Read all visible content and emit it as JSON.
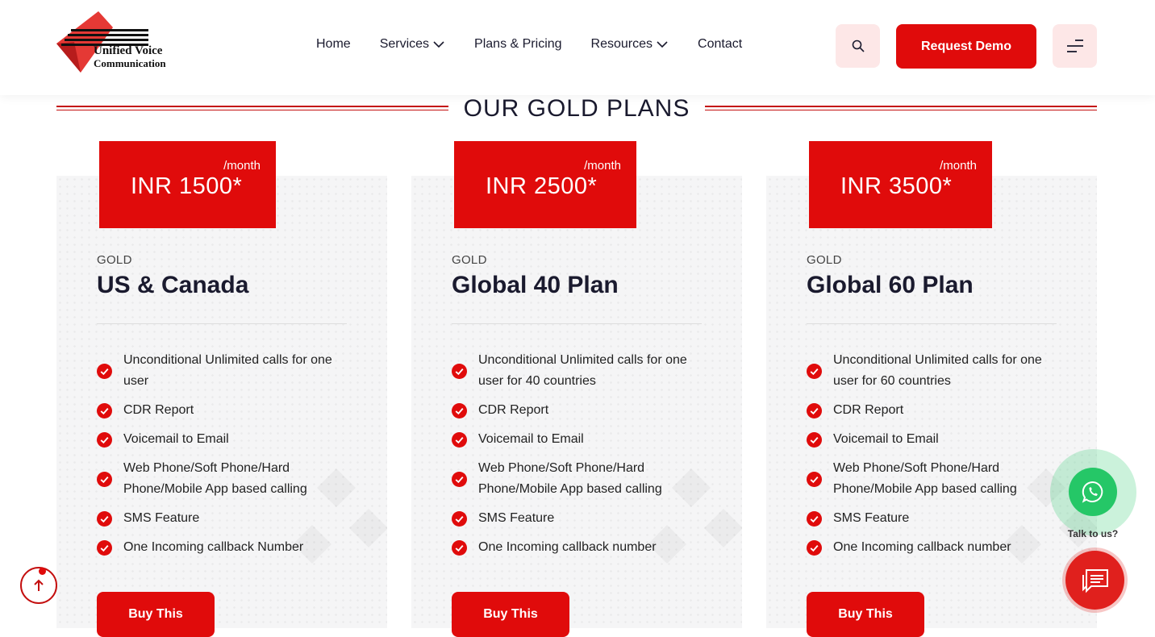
{
  "header": {
    "logo": {
      "line1": "Unified Voice",
      "line2": "Communication"
    },
    "nav": [
      {
        "label": "Home",
        "has_dropdown": false
      },
      {
        "label": "Services",
        "has_dropdown": true
      },
      {
        "label": "Plans & Pricing",
        "has_dropdown": false
      },
      {
        "label": "Resources",
        "has_dropdown": true
      },
      {
        "label": "Contact",
        "has_dropdown": false
      }
    ],
    "search_icon": "search-icon",
    "demo_label": "Request Demo",
    "menu_icon": "hamburger-icon"
  },
  "section": {
    "title": "OUR GOLD PLANS"
  },
  "plans": [
    {
      "per": "/month",
      "price": "INR 1500*",
      "tier": "GOLD",
      "name": "US & Canada",
      "features": [
        "Unconditional Unlimited calls for one user",
        "CDR Report",
        "Voicemail to Email",
        "Web Phone/Soft Phone/Hard Phone/Mobile App based calling",
        "SMS Feature",
        "One Incoming callback Number"
      ],
      "button": "Buy This"
    },
    {
      "per": "/month",
      "price": "INR 2500*",
      "tier": "GOLD",
      "name": "Global 40 Plan",
      "features": [
        "Unconditional Unlimited calls for one user for 40 countries",
        "CDR Report",
        "Voicemail to Email",
        "Web Phone/Soft Phone/Hard Phone/Mobile App based calling",
        "SMS Feature",
        "One Incoming callback number"
      ],
      "button": "Buy This"
    },
    {
      "per": "/month",
      "price": "INR 3500*",
      "tier": "GOLD",
      "name": "Global 60 Plan",
      "features": [
        "Unconditional Unlimited calls for one user for 60 countries",
        "CDR Report",
        "Voicemail to Email",
        "Web Phone/Soft Phone/Hard Phone/Mobile App based calling",
        "SMS Feature",
        "One Incoming callback number"
      ],
      "button": "Buy This"
    }
  ],
  "widgets": {
    "talk_label": "Talk to us?",
    "whatsapp_icon": "whatsapp-icon",
    "chat_icon": "chat-icon",
    "scroll_top_icon": "arrow-up-icon"
  },
  "colors": {
    "accent": "#e00b0b",
    "accent_light": "#fde7e7",
    "whatsapp": "#25c767",
    "text": "#1a1a2e"
  }
}
